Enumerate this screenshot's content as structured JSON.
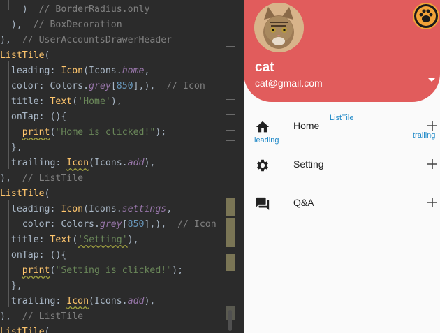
{
  "editor": {
    "lines": [
      "    )  // BorderRadius.only",
      "  ),  // BoxDecoration",
      "),  // UserAccountsDrawerHeader",
      "ListTile(",
      "  leading: Icon(Icons.home,",
      "  color: Colors.grey[850],),  // Icon",
      "  title: Text('Home'),",
      "  onTap: (){",
      "    print(\"Home is clicked!\");",
      "  },",
      "  trailing: Icon(Icons.add),",
      "),  // ListTile",
      "ListTile(",
      "  leading: Icon(Icons.settings,",
      "    color: Colors.grey[850],),  // Icon",
      "  title: Text('Setting'),",
      "  onTap: (){",
      "    print(\"Setting is clicked!\");",
      "  },",
      "  trailing: Icon(Icons.add),",
      "),  // ListTile",
      "ListTile("
    ]
  },
  "drawer": {
    "account_name": "cat",
    "account_email": "cat@gmail.com",
    "items": [
      {
        "label": "Home",
        "icon": "home-icon",
        "trailing": "add-icon"
      },
      {
        "label": "Setting",
        "icon": "settings-icon",
        "trailing": "add-icon"
      },
      {
        "label": "Q&A",
        "icon": "question-answer-icon",
        "trailing": "add-icon"
      }
    ]
  },
  "annotations": {
    "list_tile": "ListTile",
    "leading": "leading",
    "trailing": "trailing"
  },
  "colors": {
    "header": "#e15c5c",
    "annotation": "#1e88c7",
    "editor_bg": "#2b2b2b"
  }
}
